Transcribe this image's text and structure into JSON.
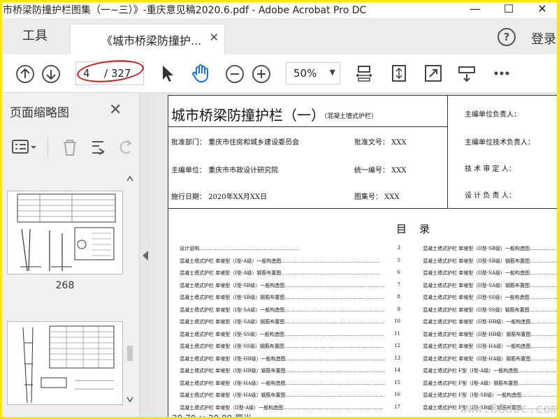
{
  "window": {
    "title": "市桥梁防撞护栏图集（一~三）》-重庆意见稿2020.6.pdf - Adobe Acrobat Pro DC",
    "minimize": "—",
    "maximize": "☐",
    "close": "✕"
  },
  "tabs": {
    "tools_label": "工具",
    "doc_tab_label": "《城市桥梁防撞护...",
    "doc_tab_close": "✕",
    "help_icon": "?",
    "login_label": "登录"
  },
  "toolbar": {
    "current_page": "4",
    "total_pages": "/ 327",
    "zoom": "50%",
    "highlight_color": "#d0181c",
    "accent_color": "#1473e6"
  },
  "sidebar": {
    "title": "页面缩略图",
    "close": "✕",
    "thumbnails": [
      {
        "label": "268"
      },
      {
        "label": ""
      }
    ]
  },
  "document": {
    "title": "城市桥梁防撞护栏（一）",
    "subtitle": "（混凝土墙式护栏）",
    "approval_dept": "批准部门：  重庆市住房和城乡建设委员会",
    "approval_no": "批准文号：  XXX",
    "editor_unit": "主编单位：  重庆市市政设计研究院",
    "unified_no": "统一编号：  XXX",
    "impl_date": "施行日期：  2020年XX月XX日",
    "atlas_no": "图集号：  XXX",
    "roles": [
      "主编单位负责人：",
      "主编单位技术负责人：",
      "技 术 审 定 人：",
      "设 计 负 责 人："
    ],
    "toc_title": "目录",
    "toc_left": [
      {
        "text": "设计说明",
        "page": "3"
      },
      {
        "text": "混凝土墙式护栏 单坡型（I型-A级）一般构造图",
        "page": "5"
      },
      {
        "text": "混凝土墙式护栏 单坡型（I型-A级）钢筋布置图",
        "page": "6"
      },
      {
        "text": "混凝土墙式护栏 单坡型（I型-SB级）一般构造图",
        "page": "7"
      },
      {
        "text": "混凝土墙式护栏 单坡型（I型-SB级）钢筋布置图",
        "page": "8"
      },
      {
        "text": "混凝土墙式护栏 单坡型（I型-SA级）一般构造图",
        "page": "9"
      },
      {
        "text": "混凝土墙式护栏 单坡型（I型-SA级）钢筋布置图",
        "page": "10"
      },
      {
        "text": "混凝土墙式护栏 单坡型（I型-SS级）一般构造图",
        "page": "11"
      },
      {
        "text": "混凝土墙式护栏 单坡型（I型-SS级）钢筋布置图",
        "page": "12"
      },
      {
        "text": "混凝土墙式护栏 单坡型（I型-HB级）一般构造图",
        "page": "13"
      },
      {
        "text": "混凝土墙式护栏 单坡型（I型-HB级）钢筋布置图",
        "page": "14"
      },
      {
        "text": "混凝土墙式护栏 单坡型（I型-HA级）一般构造图",
        "page": "15"
      },
      {
        "text": "混凝土墙式护栏 单坡型（I型-HA级）钢筋布置图",
        "page": "16"
      },
      {
        "text": "混凝土墙式护栏 单坡型（II型-A级）一般构造图",
        "page": "17"
      }
    ],
    "toc_right": [
      {
        "text": "混凝土墙式护栏 单坡型（II型-SB级）一般构造图",
        "page": ""
      },
      {
        "text": "混凝土墙式护栏 单坡型（II型-SB级）钢筋布置图",
        "page": ""
      },
      {
        "text": "混凝土墙式护栏 单坡型（II型-SA级）一般构造图",
        "page": ""
      },
      {
        "text": "混凝土墙式护栏 单坡型（II型-SA级）钢筋布置图",
        "page": ""
      },
      {
        "text": "混凝土墙式护栏 单坡型（II型-SS级）一般构造图",
        "page": ""
      },
      {
        "text": "混凝土墙式护栏 单坡型（II型-SS级）钢筋布置图",
        "page": ""
      },
      {
        "text": "混凝土墙式护栏 单坡型（II型-HB级）一般构造图",
        "page": ""
      },
      {
        "text": "混凝土墙式护栏 单坡型（II型-HB级）钢筋布置图",
        "page": ""
      },
      {
        "text": "混凝土墙式护栏 单坡型（II型-HA级）一般构造图",
        "page": ""
      },
      {
        "text": "混凝土墙式护栏 单坡型（II型-HA级）钢筋布置图",
        "page": ""
      },
      {
        "text": "混凝土墙式护栏 F型（I型-A级）一般构造图",
        "page": ""
      },
      {
        "text": "混凝土墙式护栏 F型（I型-A级）钢筋布置图",
        "page": ""
      },
      {
        "text": "混凝土墙式护栏 F型（I型-SB级）一般构造图",
        "page": ""
      },
      {
        "text": "混凝土墙式护栏 F型（I型-SB级）钢筋布置图",
        "page": ""
      }
    ]
  },
  "status": {
    "dimensions": "29.70 × 20.99 厘米"
  },
  "watermark": "www.88doc.com"
}
